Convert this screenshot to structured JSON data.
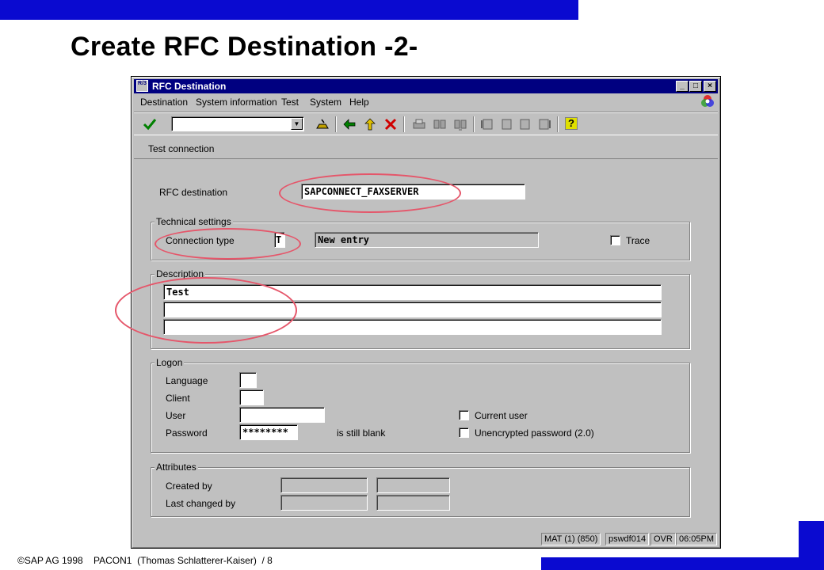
{
  "slide": {
    "title": "Create RFC Destination -2-",
    "footer": "SAP AG 1998    PACON1  (Thomas Schlatterer-Kaiser)  / 8",
    "accent_color": "#0a0ad0",
    "annotation_color": "#e5566a"
  },
  "window": {
    "title": "RFC Destination",
    "icon_text": "R/3",
    "controls": {
      "minimize": "_",
      "maximize": "□",
      "close": "×"
    }
  },
  "menubar": {
    "items": [
      {
        "label": "Destination"
      },
      {
        "label": "System information"
      },
      {
        "label": "Test"
      },
      {
        "label": "System"
      },
      {
        "label": "Help"
      }
    ]
  },
  "toolbar": {
    "enter_icon": "check-icon",
    "command_field_value": "",
    "save_icon": "save-icon",
    "back_icon": "back-arrow-icon",
    "exit_icon": "exit-up-arrow-icon",
    "cancel_icon": "cancel-x-icon",
    "help_label": "?"
  },
  "app_toolbar": {
    "test_connection_label": "Test connection"
  },
  "form": {
    "rfc_destination_label": "RFC destination",
    "rfc_destination_value": "SAPCONNECT_FAXSERVER",
    "technical_settings": {
      "title": "Technical settings",
      "connection_type_label": "Connection type",
      "connection_type_value": "T",
      "connection_type_text": "New entry",
      "trace_label": "Trace",
      "trace_checked": false
    },
    "description": {
      "title": "Description",
      "lines": [
        "Test",
        "",
        ""
      ]
    },
    "logon": {
      "title": "Logon",
      "language_label": "Language",
      "language_value": "",
      "client_label": "Client",
      "client_value": "",
      "user_label": "User",
      "user_value": "",
      "password_label": "Password",
      "password_value": "********",
      "password_status": "is still blank",
      "current_user_label": "Current user",
      "current_user_checked": false,
      "unencrypted_label": "Unencrypted password (2.0)",
      "unencrypted_checked": false
    },
    "attributes": {
      "title": "Attributes",
      "created_by_label": "Created by",
      "last_changed_by_label": "Last changed by"
    }
  },
  "statusbar": {
    "system": "MAT (1) (850)",
    "server": "pswdf014",
    "mode": "OVR",
    "time": "06:05PM"
  }
}
